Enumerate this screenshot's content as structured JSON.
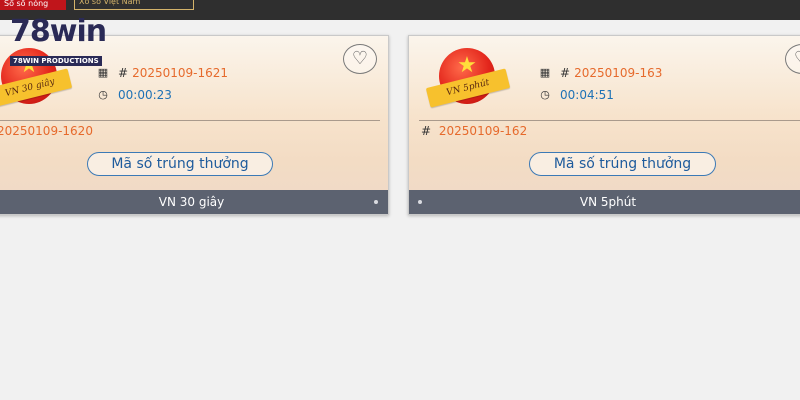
{
  "topbar": {
    "tab1": "Sổ số nóng",
    "tab2": "Xổ số Việt Nam"
  },
  "logo": {
    "main": "78win",
    "sub": "78WIN PRODUCTIONS"
  },
  "icons": {
    "calendar": "calendar-icon",
    "clock": "clock-icon",
    "heart": "heart-icon",
    "star": "star-icon"
  },
  "colors": {
    "period": "#e66a2c",
    "timer": "#1e72b6",
    "footer": "#5c6270",
    "button_border": "#3c7ab6"
  },
  "cards": [
    {
      "badge": "VN 30 giây",
      "hash": "#",
      "current_period": "20250109-1621",
      "countdown": "00:00:23",
      "last_period": "20250109-1620",
      "button": "Mã số trúng thưởng",
      "footer": "VN 30 giây"
    },
    {
      "badge": "VN 5phút",
      "hash": "#",
      "current_period": "20250109-163",
      "countdown": "00:04:51",
      "last_period": "20250109-162",
      "button": "Mã số trúng thưởng",
      "footer": "VN 5phút"
    }
  ]
}
